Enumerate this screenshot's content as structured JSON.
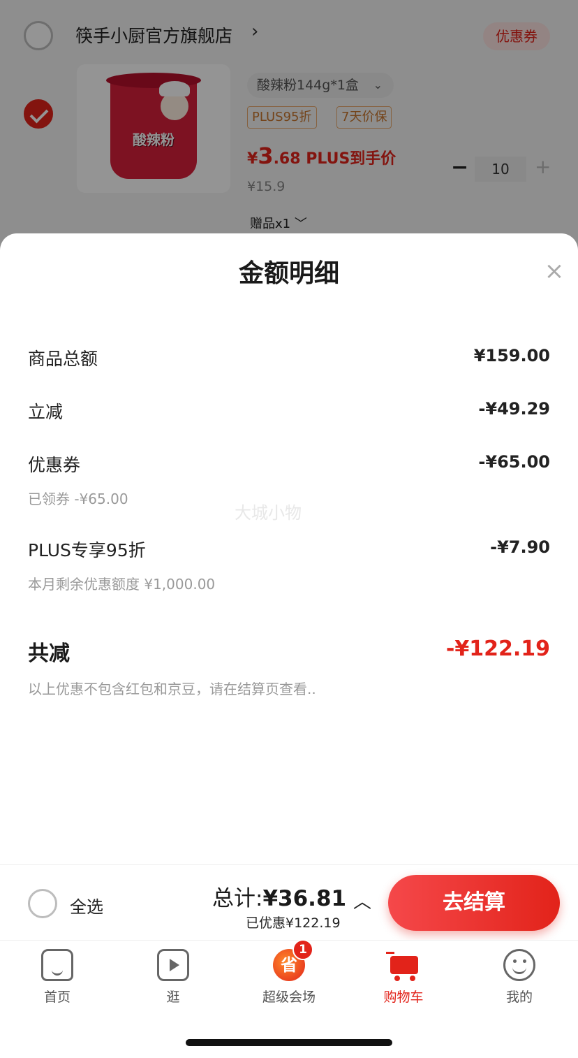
{
  "cart": {
    "shop_name": "筷手小厨官方旗舰店",
    "shop_arrow": "›",
    "coupon_tag": "优惠券",
    "product": {
      "image_label": "酸辣粉",
      "spec": "酸辣粉144g*1盒",
      "tags": [
        "PLUS95折",
        "7天价保"
      ],
      "price_symbol": "¥",
      "price_int": "3",
      "price_dec": ".68",
      "price_note": "PLUS到手价",
      "original_price": "¥15.9",
      "quantity": "10",
      "gift": "赠品x1 ﹀"
    }
  },
  "sheet": {
    "title": "金额明细",
    "close": "×",
    "rows": [
      {
        "label": "商品总额",
        "value": "¥159.00"
      },
      {
        "label": "立减",
        "value": "-¥49.29"
      },
      {
        "label": "优惠券",
        "value": "-¥65.00",
        "sub": "已领券 -¥65.00"
      },
      {
        "label": "PLUS专享95折",
        "value": "-¥7.90",
        "sub": "本月剩余优惠额度 ¥1,000.00"
      }
    ],
    "total_label": "共减",
    "total_value": "-¥122.19",
    "note": "以上优惠不包含红包和京豆，请在结算页查看..",
    "watermark": "大城小物"
  },
  "bottom_bar": {
    "select_all": "全选",
    "total_prefix": "总计:",
    "total_amount": "¥36.81",
    "saved": "已优惠¥122.19",
    "checkout": "去结算"
  },
  "tabs": [
    {
      "label": "首页",
      "icon": "home-icon"
    },
    {
      "label": "逛",
      "icon": "play-icon"
    },
    {
      "label": "超级会场",
      "icon": "super-sale-icon",
      "badge": "1",
      "glyph": "省"
    },
    {
      "label": "购物车",
      "icon": "cart-icon",
      "active": true
    },
    {
      "label": "我的",
      "icon": "profile-icon"
    }
  ],
  "colors": {
    "accent": "#e2231a",
    "tag_border": "#e8a96f"
  }
}
